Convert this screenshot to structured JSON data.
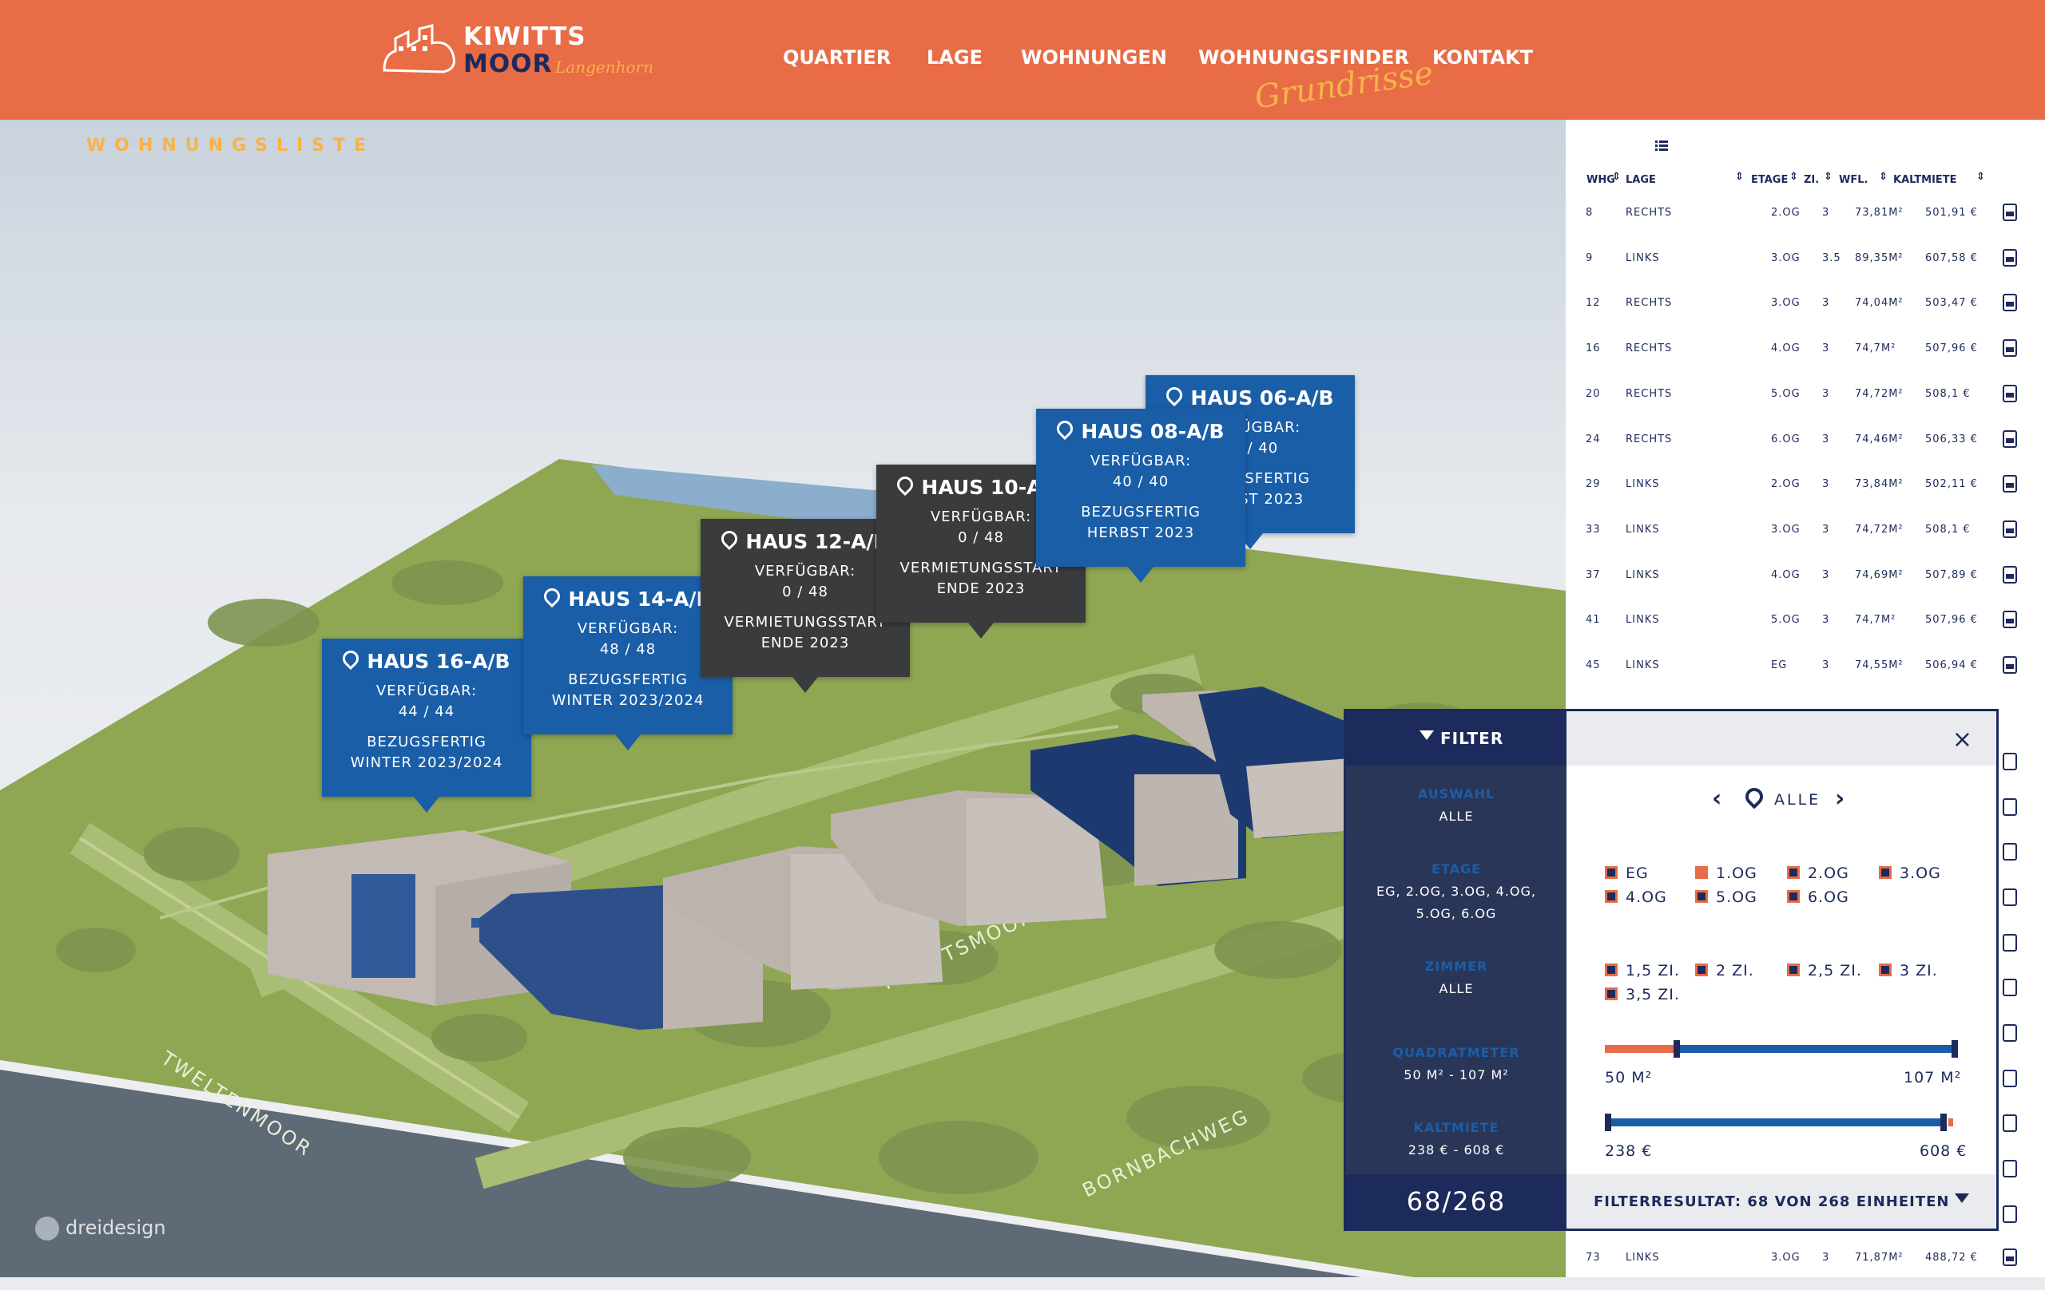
{
  "logo": {
    "line1": "KIWITTS",
    "line2": "MOOR",
    "line3": "Langenhorn"
  },
  "nav": {
    "items": [
      "QUARTIER",
      "LAGE",
      "WOHNUNGEN",
      "WOHNUNGSFINDER",
      "KONTAKT"
    ],
    "script_label": "Grundrisse"
  },
  "colors": {
    "header": "#e86c46",
    "navy": "#1d2a5c",
    "blue": "#1a5ea8",
    "accent": "#f6b34a",
    "grass": "#8fa653"
  },
  "map": {
    "houses": [
      {
        "name": "HAUS 16-A/B",
        "l1": "VERFÜGBAR:",
        "l2": "44 / 44",
        "l3": "BEZUGSFERTIG",
        "l4": "WINTER 2023/2024"
      },
      {
        "name": "HAUS 14-A/B",
        "l1": "VERFÜGBAR:",
        "l2": "48 / 48",
        "l3": "BEZUGSFERTIG",
        "l4": "WINTER 2023/2024"
      },
      {
        "name": "HAUS 12-A/B",
        "l1": "VERFÜGBAR:",
        "l2": "0 / 48",
        "l3": "VERMIETUNGSSTART",
        "l4": "ENDE 2023"
      },
      {
        "name": "HAUS 10-A/B",
        "l1": "VERFÜGBAR:",
        "l2": "0 / 48",
        "l3": "VERMIETUNGSSTART",
        "l4": "ENDE 2023"
      },
      {
        "name": "HAUS 08-A/B",
        "l1": "VERFÜGBAR:",
        "l2": "40 / 40",
        "l3": "BEZUGSFERTIG",
        "l4": "HERBST 2023"
      },
      {
        "name": "HAUS 06-A/B",
        "l1": "VERFÜGBAR:",
        "l2": "40 / 40",
        "l3": "BEZUGSFERTIG",
        "l4": "HERBST 2023"
      }
    ],
    "streets": [
      "KIWITTSMOOR",
      "TWELTENMOOR",
      "BORNBACHWEG"
    ],
    "watermark": "dreidesign"
  },
  "list": {
    "title": "WOHNUNGSLISTE",
    "headers": {
      "nr": "WHG",
      "lage": "LAGE",
      "etage": "ETAGE",
      "zimmer": "ZI.",
      "flaeche": "WFL.",
      "miete": "KALTMIETE"
    },
    "rows": [
      [
        "8",
        "RECHTS",
        "2.OG",
        "3",
        "73,81M²",
        "501,91 €"
      ],
      [
        "9",
        "LINKS",
        "3.OG",
        "3.5",
        "89,35M²",
        "607,58 €"
      ],
      [
        "12",
        "RECHTS",
        "3.OG",
        "3",
        "74,04M²",
        "503,47 €"
      ],
      [
        "16",
        "RECHTS",
        "4.OG",
        "3",
        "74,7M²",
        "507,96 €"
      ],
      [
        "20",
        "RECHTS",
        "5.OG",
        "3",
        "74,72M²",
        "508,1 €"
      ],
      [
        "24",
        "RECHTS",
        "6.OG",
        "3",
        "74,46M²",
        "506,33 €"
      ],
      [
        "29",
        "LINKS",
        "2.OG",
        "3",
        "73,84M²",
        "502,11 €"
      ],
      [
        "33",
        "LINKS",
        "3.OG",
        "3",
        "74,72M²",
        "508,1 €"
      ],
      [
        "37",
        "LINKS",
        "4.OG",
        "3",
        "74,69M²",
        "507,89 €"
      ],
      [
        "41",
        "LINKS",
        "5.OG",
        "3",
        "74,7M²",
        "507,96 €"
      ],
      [
        "45",
        "LINKS",
        "EG",
        "3",
        "74,55M²",
        "506,94 €"
      ]
    ],
    "last_row": [
      "73",
      "LINKS",
      "3.OG",
      "3",
      "71,87M²",
      "488,72 €"
    ]
  },
  "filter": {
    "title": "FILTER",
    "sections": [
      {
        "label": "AUSWAHL",
        "value": "ALLE"
      },
      {
        "label": "ETAGE",
        "value": "EG, 2.OG, 3.OG, 4.OG,",
        "value2": "5.OG, 6.OG"
      },
      {
        "label": "ZIMMER",
        "value": "ALLE"
      },
      {
        "label": "QUADRATMETER",
        "value": "50 M² - 107 M²"
      },
      {
        "label": "KALTMIETE",
        "value": "238 € - 608 €"
      }
    ],
    "count": "68/268",
    "selector": "ALLE",
    "etagen": [
      {
        "label": "EG",
        "on": false
      },
      {
        "label": "1.OG",
        "on": true
      },
      {
        "label": "2.OG",
        "on": false
      },
      {
        "label": "3.OG",
        "on": false
      },
      {
        "label": "4.OG",
        "on": false
      },
      {
        "label": "5.OG",
        "on": false
      },
      {
        "label": "6.OG",
        "on": false
      }
    ],
    "zimmer": [
      {
        "label": "1,5 ZI.",
        "on": false
      },
      {
        "label": "2 ZI.",
        "on": false
      },
      {
        "label": "2,5 ZI.",
        "on": false
      },
      {
        "label": "3 ZI.",
        "on": false
      },
      {
        "label": "3,5 ZI.",
        "on": false
      }
    ],
    "qm": {
      "min_label": "50 M²",
      "max_label": "107 M²",
      "min": 50,
      "max": 107
    },
    "miete": {
      "min_label": "238 €",
      "max_label": "608 €",
      "min": 238,
      "max": 608
    },
    "result": "FILTERRESULTAT: 68 VON 268 EINHEITEN"
  }
}
